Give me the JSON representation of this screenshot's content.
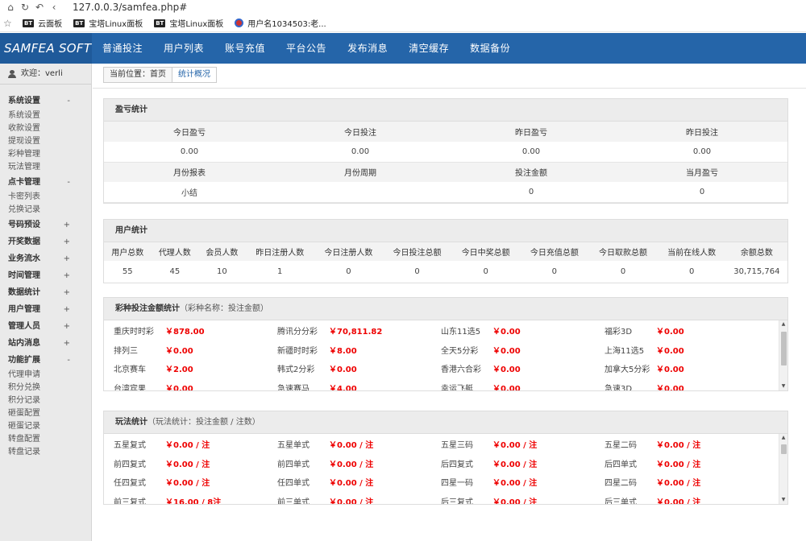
{
  "browser": {
    "url": "127.0.0.3/samfea.php#",
    "bookmarks": [
      {
        "badge": "BT",
        "label": "云面板"
      },
      {
        "badge": "BT",
        "label": "宝塔Linux面板"
      },
      {
        "badge": "BT",
        "label": "宝塔Linux面板"
      },
      {
        "badge": "",
        "label": "用户名1034503:老..."
      }
    ]
  },
  "header": {
    "logo": "SAMFEA SOFT",
    "menu": [
      "普通投注",
      "用户列表",
      "账号充值",
      "平台公告",
      "发布消息",
      "清空缓存",
      "数据备份"
    ],
    "bg_color": "#2565a9"
  },
  "sidebar": {
    "welcome": "欢迎：verli",
    "groups": [
      {
        "title": "系统设置",
        "toggle": "-",
        "items": [
          "系统设置",
          "收款设置",
          "提现设置",
          "彩种管理",
          "玩法管理"
        ]
      },
      {
        "title": "点卡管理",
        "toggle": "-",
        "items": [
          "卡密列表",
          "兑换记录"
        ]
      },
      {
        "title": "号码预设",
        "toggle": "+",
        "items": []
      },
      {
        "title": "开奖数据",
        "toggle": "+",
        "items": []
      },
      {
        "title": "业务流水",
        "toggle": "+",
        "items": []
      },
      {
        "title": "时间管理",
        "toggle": "+",
        "items": []
      },
      {
        "title": "数据统计",
        "toggle": "+",
        "items": []
      },
      {
        "title": "用户管理",
        "toggle": "+",
        "items": []
      },
      {
        "title": "管理人员",
        "toggle": "+",
        "items": []
      },
      {
        "title": "站内消息",
        "toggle": "+",
        "items": []
      },
      {
        "title": "功能扩展",
        "toggle": "-",
        "items": [
          "代理申请",
          "积分兑换",
          "积分记录",
          "砸蛋配置",
          "砸蛋记录",
          "转盘配置",
          "转盘记录"
        ]
      }
    ]
  },
  "breadcrumb": {
    "current": "当前位置：首页",
    "tab": "统计概况"
  },
  "profit": {
    "title": "盈亏统计",
    "headers1": [
      "今日盈亏",
      "今日投注",
      "昨日盈亏",
      "昨日投注"
    ],
    "values1": [
      "0.00",
      "0.00",
      "0.00",
      "0.00"
    ],
    "headers2": [
      "月份报表",
      "月份周期",
      "投注金额",
      "当月盈亏"
    ],
    "values2": [
      "小结",
      "",
      "0",
      "0"
    ]
  },
  "users": {
    "title": "用户统计",
    "headers": [
      "用户总数",
      "代理人数",
      "会员人数",
      "昨日注册人数",
      "今日注册人数",
      "今日投注总额",
      "今日中奖总额",
      "今日充值总额",
      "今日取款总额",
      "当前在线人数",
      "余额总数"
    ],
    "values": [
      "55",
      "45",
      "10",
      "1",
      "0",
      "0",
      "0",
      "0",
      "0",
      "0",
      "30,715,764"
    ]
  },
  "lottery": {
    "title": "彩种投注金额统计",
    "note": "（彩种名称：投注金额）",
    "items": [
      {
        "name": "重庆时时彩",
        "value": "￥878.00"
      },
      {
        "name": "腾讯分分彩",
        "value": "￥70,811.82"
      },
      {
        "name": "山东11选5",
        "value": "￥0.00"
      },
      {
        "name": "福彩3D",
        "value": "￥0.00"
      },
      {
        "name": "排列三",
        "value": "￥0.00"
      },
      {
        "name": "新疆时时彩",
        "value": "￥8.00"
      },
      {
        "name": "全天5分彩",
        "value": "￥0.00"
      },
      {
        "name": "上海11选5",
        "value": "￥0.00"
      },
      {
        "name": "北京赛车",
        "value": "￥2.00"
      },
      {
        "name": "韩式2分彩",
        "value": "￥0.00"
      },
      {
        "name": "香港六合彩",
        "value": "￥0.00"
      },
      {
        "name": "加拿大5分彩",
        "value": "￥0.00"
      },
      {
        "name": "台湾宾果",
        "value": "￥0.00"
      },
      {
        "name": "急速赛马",
        "value": "￥4.00"
      },
      {
        "name": "幸运飞艇",
        "value": "￥0.00"
      },
      {
        "name": "急速3D",
        "value": "￥0.00"
      }
    ]
  },
  "play": {
    "title": "玩法统计",
    "note": "（玩法统计：投注金额 / 注数）",
    "items": [
      {
        "name": "五星复式",
        "value": "￥0.00 / 注"
      },
      {
        "name": "五星单式",
        "value": "￥0.00 / 注"
      },
      {
        "name": "五星三码",
        "value": "￥0.00 / 注"
      },
      {
        "name": "五星二码",
        "value": "￥0.00 / 注"
      },
      {
        "name": "前四复式",
        "value": "￥0.00 / 注"
      },
      {
        "name": "前四单式",
        "value": "￥0.00 / 注"
      },
      {
        "name": "后四复式",
        "value": "￥0.00 / 注"
      },
      {
        "name": "后四单式",
        "value": "￥0.00 / 注"
      },
      {
        "name": "任四复式",
        "value": "￥0.00 / 注"
      },
      {
        "name": "任四单式",
        "value": "￥0.00 / 注"
      },
      {
        "name": "四星一码",
        "value": "￥0.00 / 注"
      },
      {
        "name": "四星二码",
        "value": "￥0.00 / 注"
      },
      {
        "name": "前三复式",
        "value": "￥16.00 / 8注"
      },
      {
        "name": "前三单式",
        "value": "￥0.00 / 注"
      },
      {
        "name": "后三复式",
        "value": "￥0.00 / 注"
      },
      {
        "name": "后三单式",
        "value": "￥0.00 / 注"
      }
    ]
  }
}
